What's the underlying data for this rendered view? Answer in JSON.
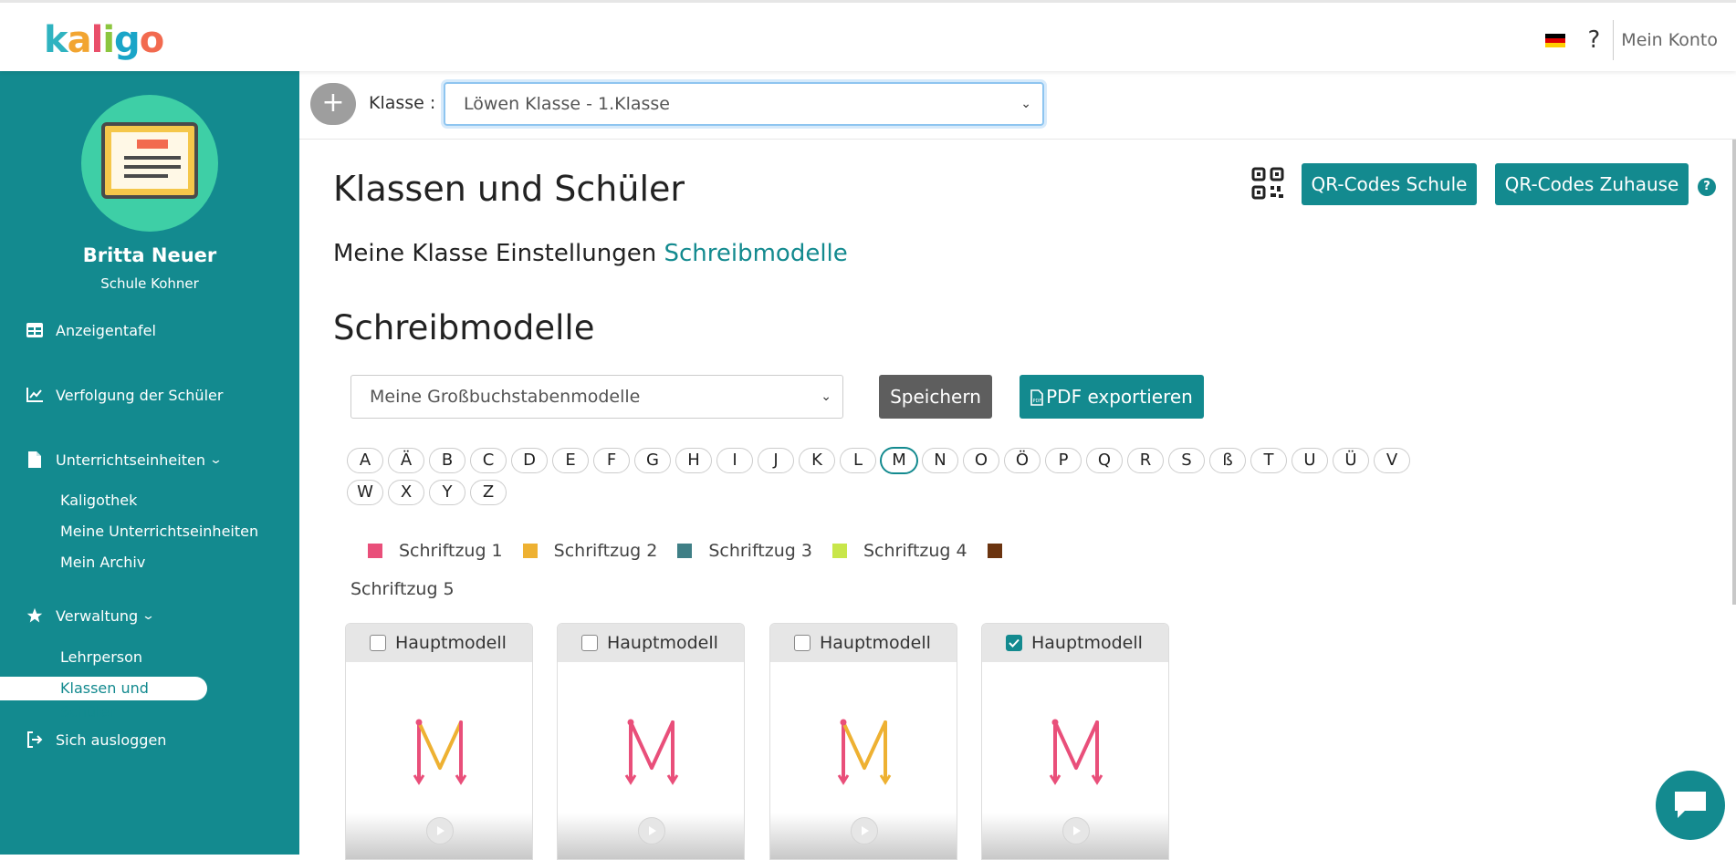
{
  "header": {
    "logo_letters": [
      "k",
      "a",
      "l",
      "i",
      "g",
      "o"
    ],
    "logo_colors": [
      "#2fb3c0",
      "#f2a531",
      "#e94f6a",
      "#8cc63f",
      "#1aa5c8",
      "#f26a4f"
    ],
    "help": "?",
    "account": "Mein Konto"
  },
  "sidebar": {
    "user_name": "Britta Neuer",
    "school": "Schule Kohner",
    "nav": {
      "dashboard": "Anzeigentafel",
      "tracking": "Verfolgung der Schüler",
      "units": "Unterrichtseinheiten",
      "units_sub": [
        "Kaligothek",
        "Meine Unterrichtseinheiten",
        "Mein Archiv"
      ],
      "admin": "Verwaltung",
      "admin_sub": [
        "Lehrperson",
        "Klassen und Schüler"
      ],
      "logout": "Sich ausloggen"
    }
  },
  "classbar": {
    "plus": "+",
    "label": "Klasse :",
    "selected_class": "Löwen Klasse - 1.Klasse"
  },
  "main": {
    "title": "Klassen und Schüler",
    "buttons": {
      "qr_school": "QR-Codes Schule",
      "qr_home": "QR-Codes Zuhause",
      "help": "?"
    },
    "breadcrumb": {
      "prefix": "Meine Klasse Einstellungen",
      "link": "Schreibmodelle"
    },
    "section_title": "Schreibmodelle",
    "model_select": "Meine Großbuchstabenmodelle",
    "save": "Speichern",
    "pdf": "PDF exportieren",
    "letters": [
      "A",
      "Ä",
      "B",
      "C",
      "D",
      "E",
      "F",
      "G",
      "H",
      "I",
      "J",
      "K",
      "L",
      "M",
      "N",
      "O",
      "Ö",
      "P",
      "Q",
      "R",
      "S",
      "ß",
      "T",
      "U",
      "Ü",
      "V",
      "W",
      "X",
      "Y",
      "Z"
    ],
    "active_letter": "M",
    "legend": [
      {
        "label": "Schriftzug 1",
        "color": "#e94f7a"
      },
      {
        "label": "Schriftzug 2",
        "color": "#eeb132"
      },
      {
        "label": "Schriftzug 3",
        "color": "#3f7f86"
      },
      {
        "label": "Schriftzug 4",
        "color": "#c8e64a"
      },
      {
        "label": "Schriftzug 5",
        "color": "#6b3410"
      }
    ],
    "cards": [
      {
        "label": "Hauptmodell",
        "checked": false,
        "letter": "M",
        "strokes": [
          "pink",
          "yellow",
          "pink"
        ]
      },
      {
        "label": "Hauptmodell",
        "checked": false,
        "letter": "M",
        "strokes": [
          "pink",
          "pink",
          "pink"
        ]
      },
      {
        "label": "Hauptmodell",
        "checked": false,
        "letter": "M",
        "strokes": [
          "pink",
          "yellow",
          "yellow"
        ]
      },
      {
        "label": "Hauptmodell",
        "checked": true,
        "letter": "M",
        "strokes": [
          "pink",
          "pink",
          "pink"
        ]
      }
    ]
  }
}
